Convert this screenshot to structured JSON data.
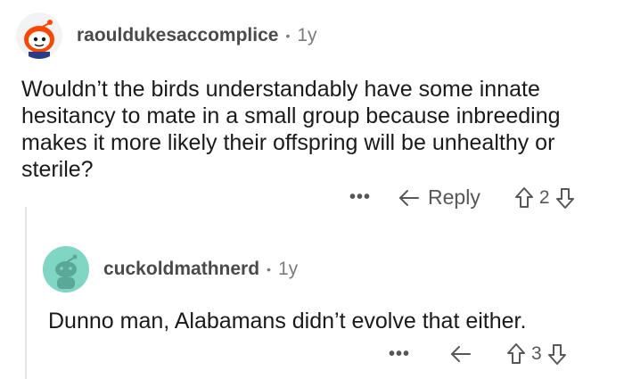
{
  "colors": {
    "avatar1_bg": "#ff4500",
    "avatar2_bg": "#7fd6c2",
    "text": "#1a1a1b",
    "muted": "#7c7c7c",
    "thread_line": "#e6e7e8"
  },
  "comments": [
    {
      "username": "raouldukesaccomplice",
      "separator": "•",
      "age": "1y",
      "body_lines": [
        "Wouldn’t the birds understandably have some innate",
        "hesitancy to mate in a small group because inbreeding",
        "makes it more likely their offspring will be unhealthy or",
        "sterile?"
      ],
      "more_label": "•••",
      "reply_label": "Reply",
      "score": "2",
      "icons": [
        "avatar-icon",
        "more-icon",
        "reply-arrow-icon",
        "upvote-icon",
        "downvote-icon"
      ]
    },
    {
      "username": "cuckoldmathnerd",
      "separator": "•",
      "age": "1y",
      "body_lines": [
        "Dunno man, Alabamans didn’t evolve that either."
      ],
      "more_label": "•••",
      "score": "3",
      "icons": [
        "avatar-icon",
        "more-icon",
        "reply-arrow-icon",
        "upvote-icon",
        "downvote-icon"
      ]
    }
  ]
}
